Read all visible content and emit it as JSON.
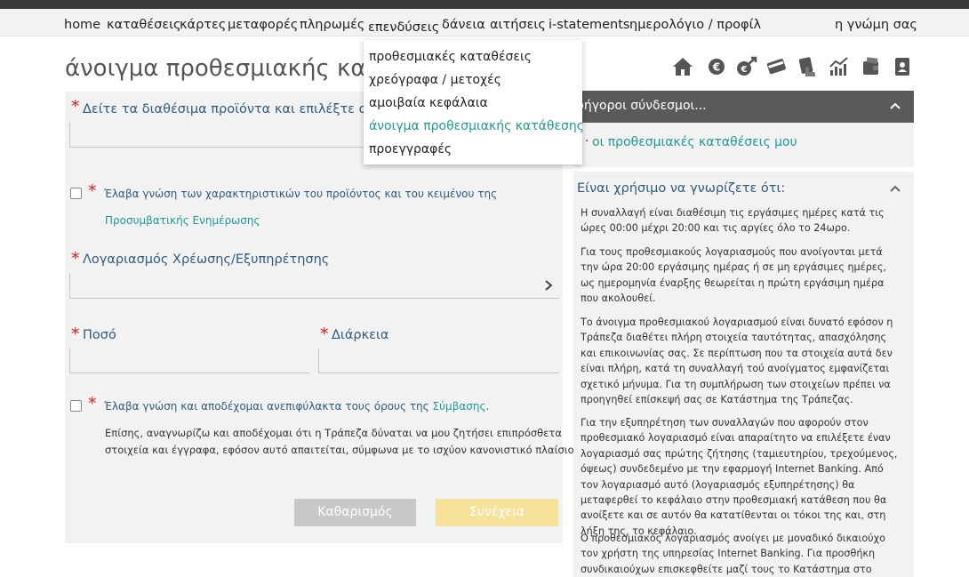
{
  "nav": {
    "items": [
      "home",
      "καταθέσεις",
      "κάρτες",
      "μεταφορές",
      "πληρωμές",
      "επενδύσεις",
      "δάνεια",
      "αιτήσεις",
      "i-statements",
      "ημερολόγιο / προφίλ"
    ],
    "feedback": "η γνώμη σας",
    "active": "επενδύσεις"
  },
  "dropdown": {
    "items": [
      "προθεσμιακές καταθέσεις",
      "χρεόγραφα / μετοχές",
      "αμοιβαία κεφάλαια",
      "άνοιγμα προθεσμιακής κατάθεσης",
      "προεγγραφές"
    ],
    "active_index": 3
  },
  "page": {
    "title": "άνοιγμα προθεσμιακής κατάθ"
  },
  "toolbar_icons": [
    "home-icon",
    "euro-icon",
    "transfer-icon",
    "card-icon",
    "payment-icon",
    "chart-icon",
    "wallet-icon",
    "contacts-icon"
  ],
  "form": {
    "product_label": "Δείτε τα διαθέσιμα προϊόντα και επιλέξτε αυτό π",
    "consent1_text": "Έλαβα γνώση των χαρακτηριστικών του προϊόντος και του κειμένου της",
    "consent1_link": "Προσυμβατικής Ενημέρωσης",
    "account_label": "Λογαριασμός Χρέωσης/Εξυπηρέτησης",
    "amount_label": "Ποσό",
    "duration_label": "Διάρκεια",
    "consent2_text": "Έλαβα γνώση και αποδέχομαι ανεπιφύλακτα τους όρους της",
    "consent2_link": "Σύμβασης",
    "consent2_end": ".",
    "note_line1": "Επίσης, αναγνωρίζω και αποδέχομαι ότι η Τράπεζα δύναται να μου ζητήσει επιπρόσθετα",
    "note_line2": "στοιχεία και έγγραφα, εφόσον αυτό απαιτείται, σύμφωνα με το ισχύον κανονιστικό πλαίσιο.",
    "clear_button": "Καθαρισμός",
    "continue_button": "Συνέχεια"
  },
  "quick_links": {
    "title": "ρήγοροι σύνδεσμοι...",
    "bullet": "·",
    "link": "οι προθεσμιακές καταθέσεις μου"
  },
  "info": {
    "title": "Είναι χρήσιμο να γνωρίζετε ότι:",
    "p1": "Η συναλλαγή είναι διαθέσιμη τις εργάσιμες ημέρες κατά τις ώρες 00:00 μέχρι 20:00 και τις αργίες όλο το 24ωρο.",
    "p2": "Για τους προθεσμιακούς λογαριασμούς που ανοίγονται μετά την ώρα 20:00 εργάσιμης ημέρας ή σε μη εργάσιμες ημέρες, ως ημερομηνία έναρξης θεωρείται η πρώτη εργάσιμη ημέρα που ακολουθεί.",
    "p3": "Το άνοιγμα προθεσμιακού λογαριασμού είναι δυνατό εφόσον η Τράπεζα διαθέτει πλήρη στοιχεία ταυτότητας, απασχόλησης και επικοινωνίας σας. Σε περίπτωση που τα στοιχεία αυτά δεν είναι πλήρη, κατά τη συναλλαγή τού ανοίγματος εμφανίζεται σχετικό μήνυμα. Για τη συμπλήρωση των στοιχείων πρέπει να προηγηθεί επίσκεψή σας σε Κατάστημα της Τράπεζας.",
    "p4": "Για την εξυπηρέτηση των συναλλαγών που αφορούν στον προθεσμιακό λογαριασμό είναι απαραίτητο να επιλέξετε έναν λογαριασμό σας πρώτης ζήτησης (ταμιευτηρίου, τρεχούμενος, όψεως) συνδεδεμένο με την εφαρμογή Internet Banking. Από τον λογαριασμό αυτό (λογαριασμός εξυπηρέτησης) θα μεταφερθεί το κεφάλαιο στην προθεσμιακή κατάθεση που θα ανοίξετε και σε αυτόν θα κατατίθενται οι τόκοι της και, στη λήξη της, το κεφάλαιο.",
    "p5": "Ο προθεσμιακός λογαριασμός ανοίγει με μοναδικό δικαιούχο τον χρήστη της υπηρεσίας Internet Banking. Για προσθήκη συνδικαιούχων επισκεφθείτε μαζί τους το Κατάστημα στο οποίο έχει"
  },
  "colors": {
    "accent": "#1f9b92",
    "required": "#e11d1d",
    "label": "#2f5d7c"
  }
}
